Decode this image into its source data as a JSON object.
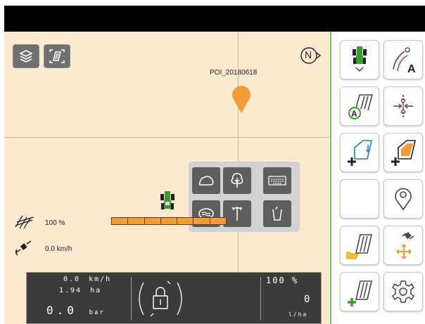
{
  "colors": {
    "map_background": "#fbead0",
    "poi_marker": "#f29d38",
    "boom_section": "#f29d38",
    "panel_border": "#7fc35b",
    "accent_green": "#3a9b2f",
    "accent_blue": "#1f78d1"
  },
  "map": {
    "compass_label": "N",
    "poi_label": "POI_20180618",
    "workwidth_percent": "100 %",
    "speed": "0.0 km/h",
    "boom_sections": 7
  },
  "map_buttons": [
    {
      "icon": "layers-icon"
    },
    {
      "icon": "map-zoom-icon"
    }
  ],
  "poi_menu": [
    {
      "icon": "stone-icon"
    },
    {
      "icon": "tree-icon"
    },
    {
      "icon": "keyboard-icon"
    },
    {
      "icon": "wetland-icon"
    },
    {
      "icon": "pole-icon"
    },
    {
      "icon": "trash-bin-icon"
    }
  ],
  "side_panel": [
    {
      "icon": "tractor-view-icon",
      "text": ""
    },
    {
      "icon": "guidance-line-a-icon",
      "text": "A"
    },
    {
      "icon": "track-a-icon",
      "text": "A"
    },
    {
      "icon": "headland-icon",
      "text": ""
    },
    {
      "icon": "add-field-boundary-icon",
      "text": ""
    },
    {
      "icon": "add-field-icon",
      "text": ""
    },
    {
      "icon": "empty-icon",
      "text": ""
    },
    {
      "icon": "location-pin-icon",
      "text": ""
    },
    {
      "icon": "load-field-icon",
      "text": ""
    },
    {
      "icon": "gnss-move-icon",
      "text": ""
    },
    {
      "icon": "new-field-icon",
      "text": ""
    },
    {
      "icon": "settings-gear-icon",
      "text": ""
    }
  ],
  "info_bar": {
    "speed_value": "0.0",
    "speed_unit": "km/h",
    "area_value": "1.94",
    "area_unit": "ha",
    "pressure_value": "0.0",
    "pressure_unit": "bar",
    "rate_percent": "100 %",
    "rate_value": "0",
    "rate_unit": "l/ha"
  }
}
